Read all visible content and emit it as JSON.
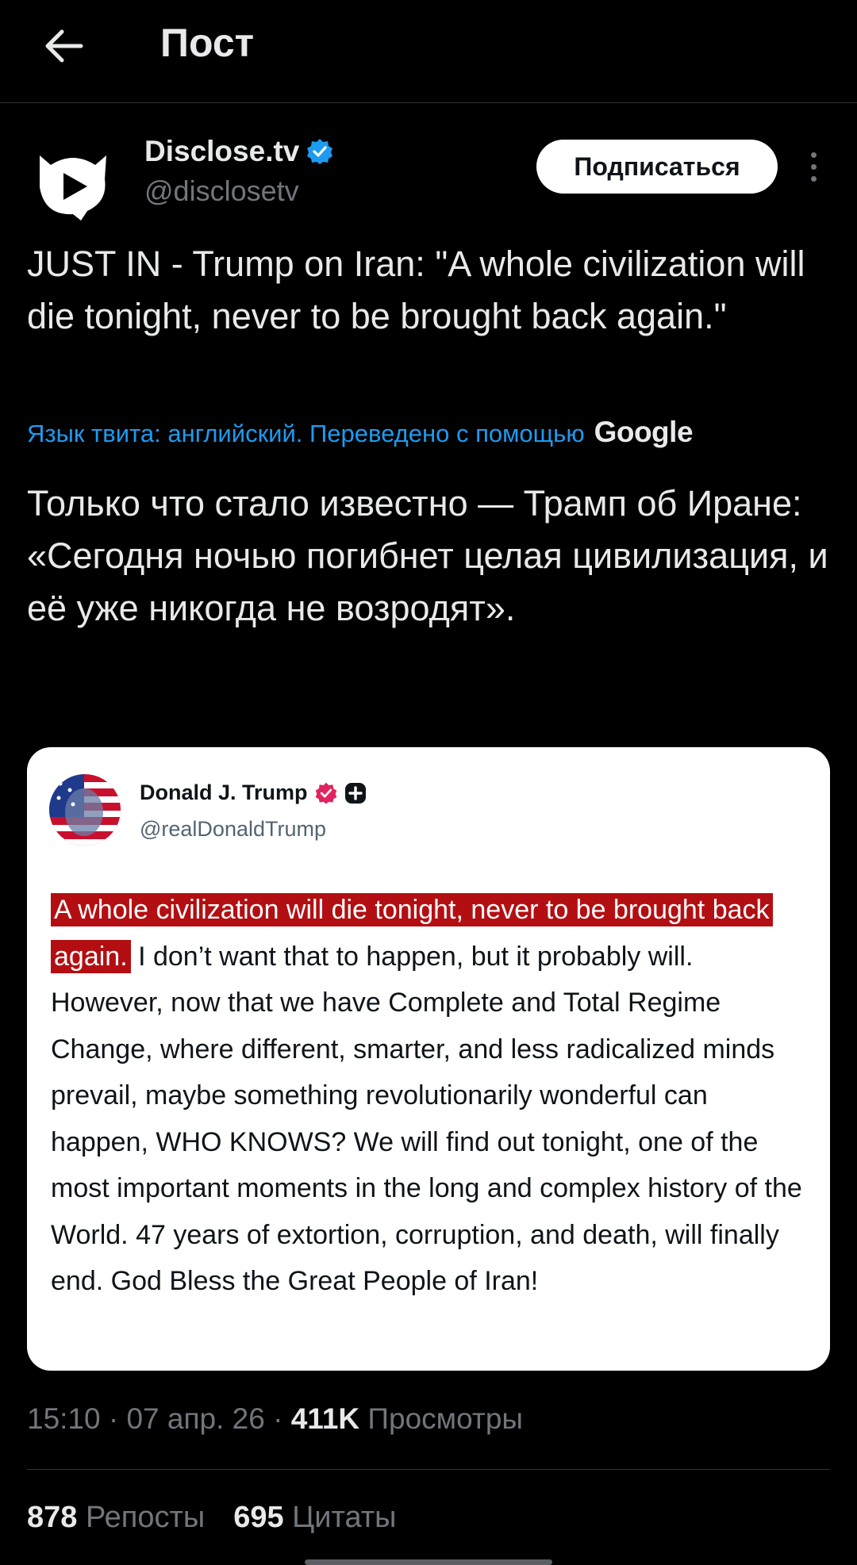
{
  "header": {
    "title": "Пост"
  },
  "author": {
    "display_name": "Disclose.tv",
    "handle": "@disclosetv",
    "verified": true,
    "follow_label": "Подписаться"
  },
  "tweet": {
    "text": "JUST IN - Trump on Iran: \"A whole civilization will die tonight, never to be brought back again.\"",
    "translation_note": "Язык твита: английский. Переведено с помощью",
    "translation_provider": "Google",
    "translated_text": "Только что стало известно — Трамп об Иране: «Сегодня ночью погибнет целая цивилизация, и её уже никогда не возродят»."
  },
  "embed": {
    "display_name": "Donald J. Trump",
    "handle": "@realDonaldTrump",
    "highlighted": "A whole civilization will die tonight, never to be brought back again.",
    "body": " I don’t want that to happen, but it probably will. However, now that we have Complete and Total Regime Change, where different, smarter, and less radicalized minds prevail, maybe something revolutionarily wonderful can happen, WHO KNOWS? We will find out tonight, one of the most important moments in the long and complex history of the World. 47 years of extortion, corruption, and death, will finally end. God Bless the Great People of Iran!"
  },
  "meta": {
    "time": "15:10",
    "sep1": " · ",
    "date": "07 апр. 26",
    "sep2": " · ",
    "views_count": "411K",
    "views_label": " Просмотры"
  },
  "stats": {
    "reposts_count": "878",
    "reposts_label": " Репосты",
    "quotes_count": "695",
    "quotes_label": " Цитаты"
  },
  "colors": {
    "background": "#000000",
    "link_blue": "#1d9bf0",
    "verified_blue": "#1d9bf0",
    "verified_pink": "#e0245e",
    "highlight_red": "#b30f12"
  },
  "icons": [
    "back-arrow-icon",
    "verified-badge-icon",
    "more-options-icon",
    "pink-verified-badge-icon",
    "plus-badge-icon"
  ]
}
